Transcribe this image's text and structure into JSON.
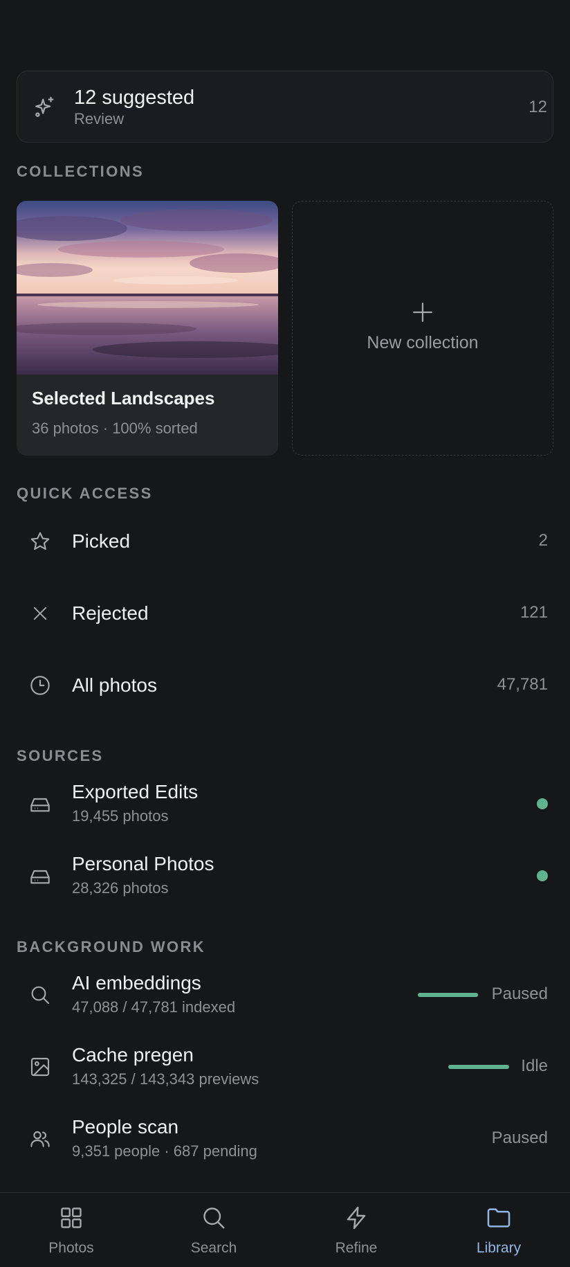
{
  "suggested": {
    "title": "12 suggested",
    "subtitle": "Review",
    "count": "12"
  },
  "sections": {
    "collections": "COLLECTIONS",
    "quick_access": "QUICK ACCESS",
    "sources": "SOURCES",
    "background_work": "BACKGROUND WORK"
  },
  "collections": {
    "items": [
      {
        "name": "Selected Landscapes",
        "meta": "36 photos · 100% sorted"
      }
    ],
    "new_label": "New collection"
  },
  "quick_access": [
    {
      "label": "Picked",
      "count": "2",
      "icon": "star-icon"
    },
    {
      "label": "Rejected",
      "count": "121",
      "icon": "close-icon"
    },
    {
      "label": "All photos",
      "count": "47,781",
      "icon": "clock-icon"
    }
  ],
  "sources": [
    {
      "name": "Exported Edits",
      "detail": "19,455 photos",
      "status_color": "#5fb38f",
      "icon": "drive-icon"
    },
    {
      "name": "Personal Photos",
      "detail": "28,326 photos",
      "status_color": "#5fb38f",
      "icon": "drive-icon"
    }
  ],
  "background_work": [
    {
      "name": "AI embeddings",
      "detail": "47,088 / 47,781 indexed",
      "status": "Paused",
      "progress": 0.985,
      "icon": "search-icon"
    },
    {
      "name": "Cache pregen",
      "detail": "143,325 / 143,343 previews",
      "status": "Idle",
      "progress": 0.9999,
      "icon": "image-icon"
    },
    {
      "name": "People scan",
      "detail": "9,351 people · 687 pending",
      "status": "Paused",
      "icon": "people-icon"
    }
  ],
  "nav": [
    {
      "label": "Photos",
      "icon": "grid-icon"
    },
    {
      "label": "Search",
      "icon": "search-icon"
    },
    {
      "label": "Refine",
      "icon": "bolt-icon"
    },
    {
      "label": "Library",
      "icon": "folder-icon",
      "active": true
    }
  ],
  "colors": {
    "accent": "#8fb6e6",
    "progress": "#5fb38f",
    "background": "#161719"
  }
}
